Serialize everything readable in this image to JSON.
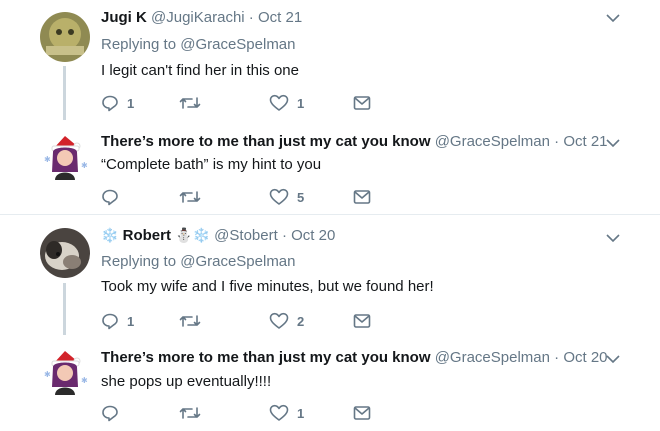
{
  "tweets": [
    {
      "name": "Jugi K",
      "handle": "@JugiKarachi",
      "dot": "·",
      "date": "Oct 21",
      "replying_prefix": "Replying to",
      "replying_to": "@GraceSpelman",
      "text": "I legit can't find her in this one",
      "reply_count": "1",
      "retweet_count": "",
      "like_count": "1"
    },
    {
      "name": "There’s more to me than just my cat you know",
      "handle": "@GraceSpelman",
      "dot": "·",
      "date": "Oct 21",
      "text": "“Complete bath” is my hint to you",
      "reply_count": "",
      "retweet_count": "",
      "like_count": "5"
    },
    {
      "name": "Robert",
      "name_decor_left": "❄️",
      "name_decor_right": "⛄❄️",
      "handle": "@Stobert",
      "dot": "·",
      "date": "Oct 20",
      "replying_prefix": "Replying to",
      "replying_to": "@GraceSpelman",
      "text": "Took my wife and I five minutes, but we found her!",
      "reply_count": "1",
      "retweet_count": "",
      "like_count": "2"
    },
    {
      "name": "There’s more to me than just my cat you know",
      "handle": "@GraceSpelman",
      "dot": "·",
      "date": "Oct 20",
      "text": "she pops up eventually!!!!",
      "reply_count": "",
      "retweet_count": "",
      "like_count": "1"
    }
  ],
  "icons": {
    "reply": "reply-icon",
    "retweet": "retweet-icon",
    "like": "heart-icon",
    "dm": "envelope-icon",
    "more": "chevron-down-icon"
  },
  "colors": {
    "icon": "#657786",
    "name": "#14171a",
    "secondary": "#657786",
    "thread_line": "#ccd6dd",
    "divider": "#e6ecf0"
  }
}
